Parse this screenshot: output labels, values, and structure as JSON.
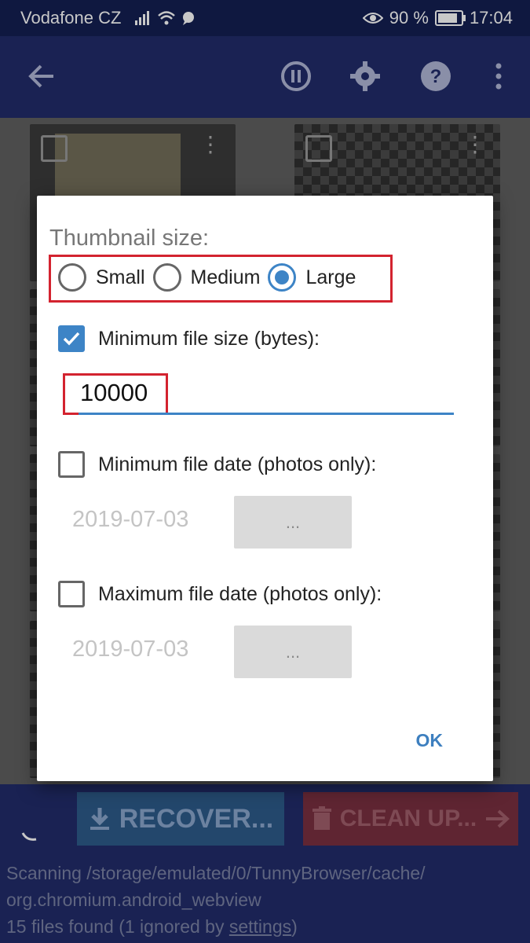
{
  "status_bar": {
    "carrier": "Vodafone CZ",
    "battery": "90 %",
    "time": "17:04"
  },
  "app_bar": {
    "icons": [
      "arrow-back-icon",
      "pause-icon",
      "gear-icon",
      "help-icon",
      "more-vert-icon"
    ]
  },
  "dialog": {
    "title": "Thumbnail size:",
    "thumbnail_options": [
      {
        "label": "Small",
        "selected": false
      },
      {
        "label": "Medium",
        "selected": false
      },
      {
        "label": "Large",
        "selected": true
      }
    ],
    "min_size": {
      "label": "Minimum file size (bytes):",
      "checked": true,
      "value": "10000"
    },
    "min_date": {
      "label": "Minimum file date (photos only):",
      "checked": false,
      "date": "2019-07-03",
      "button": "..."
    },
    "max_date": {
      "label": "Maximum file date (photos only):",
      "checked": false,
      "date": "2019-07-03",
      "button": "..."
    },
    "ok_label": "OK",
    "highlight_color": "#d3232f",
    "accent_color": "#3d84c6"
  },
  "bottom_bar": {
    "recover_label": "RECOVER...",
    "cleanup_label": "CLEAN UP...",
    "scan_line1": "Scanning /storage/emulated/0/TunnyBrowser/cache/",
    "scan_line2": "org.chromium.android_webview",
    "found_prefix": "15 files found (1 ignored by ",
    "found_link": "settings",
    "found_suffix": ")"
  }
}
